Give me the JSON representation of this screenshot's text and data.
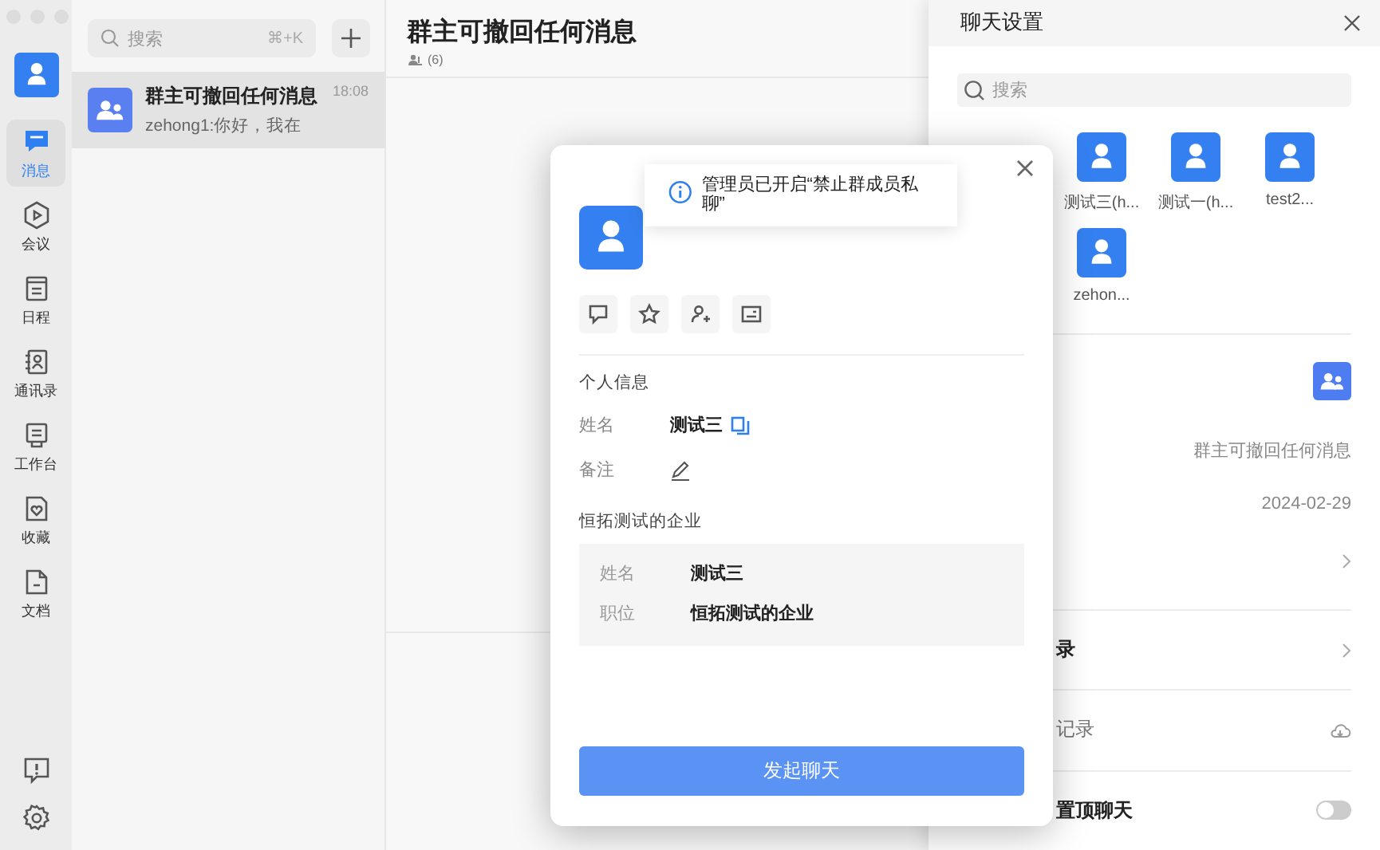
{
  "rail": {
    "items": [
      {
        "label": "消息",
        "selected": true
      },
      {
        "label": "会议",
        "selected": false
      },
      {
        "label": "日程",
        "selected": false
      },
      {
        "label": "通讯录",
        "selected": false
      },
      {
        "label": "工作台",
        "selected": false
      },
      {
        "label": "收藏",
        "selected": false
      },
      {
        "label": "文档",
        "selected": false
      }
    ]
  },
  "chat_list": {
    "search": {
      "placeholder": "搜索",
      "shortcut": "⌘+K"
    },
    "conversations": [
      {
        "title": "群主可撤回任何消息",
        "preview": "zehong1:你好，我在",
        "time": "18:08",
        "selected": true
      }
    ]
  },
  "chat": {
    "title": "群主可撤回任何消息",
    "member_count": "(6)"
  },
  "settings": {
    "title": "聊天设置",
    "search": {
      "placeholder": "搜索"
    },
    "members": [
      "测试三(h...",
      "测试一(h...",
      "test2...",
      "zehon..."
    ],
    "group_name": "群主可撤回任何消息",
    "created": "2024-02-29",
    "rows": [
      {
        "kind": "link"
      },
      {
        "kind": "link",
        "label": "录"
      },
      {
        "kind": "cloud",
        "label": "记录"
      },
      {
        "kind": "toggle",
        "label": "置顶聊天",
        "on": false
      }
    ]
  },
  "profile": {
    "toast": "管理员已开启“禁止群成员私聊”",
    "section_title": "个人信息",
    "fields": [
      {
        "kind": "copy",
        "label": "姓名",
        "value": "测试三"
      },
      {
        "kind": "edit",
        "label": "备注"
      }
    ],
    "company": "恒拓测试的企业",
    "company_fields": [
      {
        "label": "姓名",
        "value": "测试三"
      },
      {
        "label": "职位",
        "value": "恒拓测试的企业"
      }
    ],
    "button": "发起聊天"
  }
}
